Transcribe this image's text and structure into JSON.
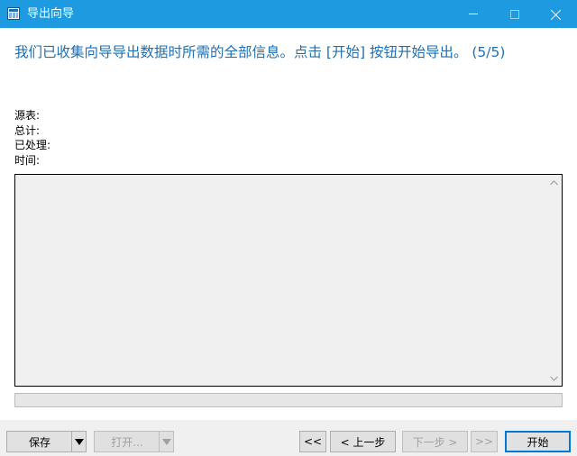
{
  "window": {
    "title": "导出向导",
    "icon": "table-grid-icon",
    "controls": {
      "minimize": "minimize-icon",
      "maximize": "maximize-icon",
      "close": "close-icon"
    }
  },
  "heading": "我们已收集向导导出数据时所需的全部信息。点击 [开始] 按钮开始导出。 (5/5)",
  "info": {
    "source_label": "源表:",
    "total_label": "总计:",
    "processed_label": "已处理:",
    "time_label": "时间:"
  },
  "log": {
    "text": ""
  },
  "progress": {
    "value": 0
  },
  "buttons": {
    "save": "保存",
    "open": "打开...",
    "first": "<<",
    "prev": "< 上一步",
    "next": "下一步 >",
    "last": ">>",
    "start": "开始"
  },
  "colors": {
    "titlebar": "#1e9ae0",
    "heading": "#1f6fb2",
    "accent": "#0078d7"
  }
}
